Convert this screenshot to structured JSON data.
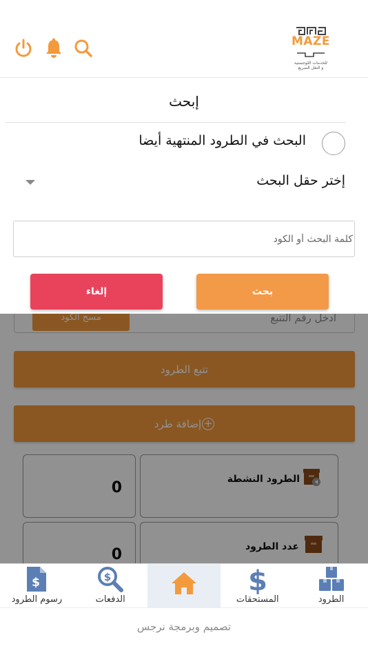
{
  "header": {
    "logo_name": "MAZE",
    "logo_tagline_1": "للخدمات اللوجستية",
    "logo_tagline_2": "و النقل السريع",
    "icons": [
      "power-icon",
      "bell-icon",
      "search-icon"
    ],
    "accent_color": "#f39a3c"
  },
  "search_sheet": {
    "title": "إبحث",
    "include_finished_label": "البحث في الطرود المنتهية أيضا",
    "include_finished_checked": false,
    "field_select_label": "إختر حقل البحث",
    "input_placeholder": "كلمة البحث أو الكود",
    "input_value": "",
    "search_button": "بحث",
    "cancel_button": "إلغاء",
    "search_color": "#f39a48",
    "cancel_color": "#e9435c"
  },
  "home": {
    "tracking_placeholder": "أدخل رقم التتبع",
    "scan_button": "مسح الكود",
    "track_button": "تتبع الطرود",
    "add_parcel_button": "إضافة طرد",
    "stats": [
      {
        "label": "الطرود النشطة",
        "value": "0",
        "icon": "active-parcels-icon"
      },
      {
        "label": "عدد الطرود",
        "value": "0",
        "icon": "parcels-count-icon"
      }
    ]
  },
  "tabbar": {
    "items": [
      {
        "label": "رسوم الطرود",
        "icon": "invoice-dollar-icon",
        "active": false
      },
      {
        "label": "الدفعات",
        "icon": "search-dollar-icon",
        "active": false
      },
      {
        "label": "",
        "icon": "home-icon",
        "active": true
      },
      {
        "label": "المستحقات",
        "icon": "dollar-icon",
        "active": false
      },
      {
        "label": "الطرود",
        "icon": "boxes-icon",
        "active": false
      }
    ],
    "icon_color": "#5b7fb5",
    "home_color": "#f39a3c"
  },
  "footer": {
    "credit": "تصميم وبرمجة نرجس"
  }
}
